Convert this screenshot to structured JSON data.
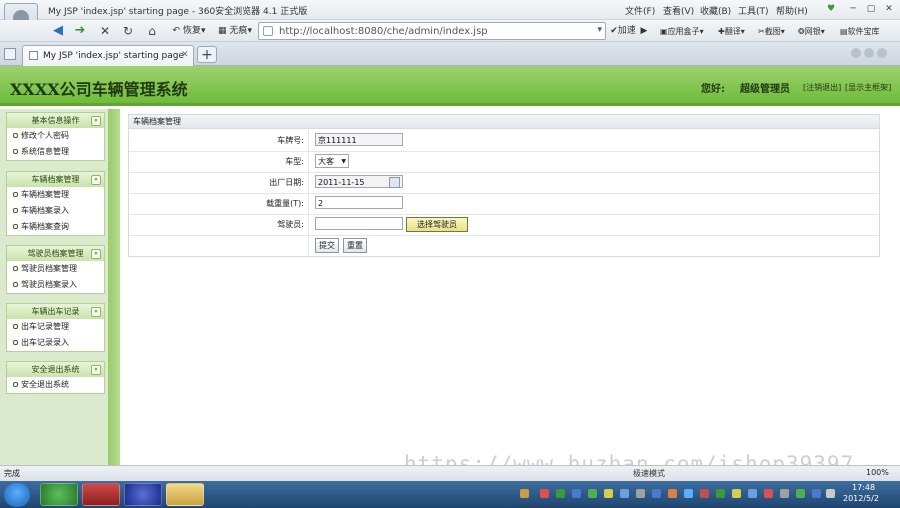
{
  "browser": {
    "window_title": "My JSP 'index.jsp' starting page - 360安全浏览器 4.1 正式版",
    "menu": [
      "文件(F)",
      "查看(V)",
      "收藏(B)",
      "工具(T)",
      "帮助(H)"
    ],
    "nav": {
      "restore_label": "恢复",
      "no_trace_label": "无痕"
    },
    "address": "http://localhost:8080/che/admin/index.jsp",
    "accelerate_label": "加速",
    "toolbar_items": [
      "应用盒子",
      "翻译",
      "截图",
      "网银",
      "软件宝库"
    ],
    "tab_label": "My JSP 'index.jsp' starting page",
    "status_text": "完成",
    "status_mode": "极速模式",
    "zoom": "100%"
  },
  "app": {
    "title": "XXXX公司车辆管理系统",
    "greeting": "您好:",
    "user": "超级管理员",
    "logout": "[注销退出]",
    "home": "[显示主框架]"
  },
  "sidebar": {
    "groups": [
      {
        "title": "基本信息操作",
        "items": [
          "修改个人密码",
          "系统信息管理"
        ]
      },
      {
        "title": "车辆档案管理",
        "items": [
          "车辆档案管理",
          "车辆档案录入",
          "车辆档案查询"
        ]
      },
      {
        "title": "驾驶员档案管理",
        "items": [
          "驾驶员档案管理",
          "驾驶员档案录入"
        ]
      },
      {
        "title": "车辆出车记录",
        "items": [
          "出车记录管理",
          "出车记录录入"
        ]
      },
      {
        "title": "安全退出系统",
        "items": [
          "安全退出系统"
        ]
      }
    ]
  },
  "form": {
    "panel_title": "车辆档案管理",
    "plate_label": "车牌号:",
    "plate_value": "京111111",
    "type_label": "车型:",
    "type_value": "大客",
    "date_label": "出厂日期:",
    "date_value": "2011-11-15",
    "load_label": "载重量(T):",
    "load_value": "2",
    "driver_label": "驾驶员:",
    "driver_value": "",
    "pick_driver": "选择驾驶员",
    "submit": "提交",
    "reset": "重置"
  },
  "watermark": "https://www.huzhan.com/ishop39397",
  "taskbar": {
    "time": "17:48",
    "date": "2012/5/2"
  },
  "colors": {
    "header_green": "#7cc44a",
    "sidebar_green": "#dbe9cd"
  }
}
